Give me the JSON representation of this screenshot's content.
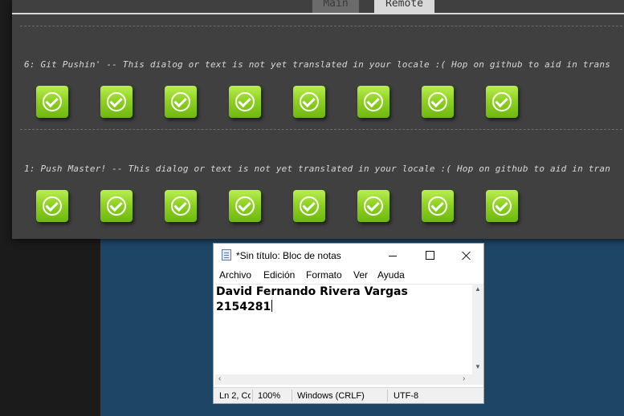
{
  "dialog": {
    "tabs": [
      {
        "label": "Main",
        "active": false
      },
      {
        "label": "Remote",
        "active": true
      }
    ],
    "levels": [
      {
        "text": "6: Git Pushin' -- This dialog or text is not yet translated in your locale :( Hop on github to aid in trans",
        "completed_count": 8
      },
      {
        "text": "1: Push Master! -- This dialog or text is not yet translated in your locale :( Hop on github to aid in tran",
        "completed_count": 8
      }
    ],
    "check_icon": "green-check-badge-icon"
  },
  "notepad": {
    "title": "*Sin título: Bloc de notas",
    "menu": [
      "Archivo",
      "Edición",
      "Formato",
      "Ver",
      "Ayuda"
    ],
    "content": [
      "David Fernando Rivera Vargas",
      "2154281"
    ],
    "status": {
      "position": "Ln 2, Co",
      "zoom": "100%",
      "line_ending": "Windows (CRLF)",
      "encoding": "UTF-8"
    }
  },
  "colors": {
    "dialog_bg": "#404040",
    "check_green": "#8fd21f",
    "desktop_blue": "#1d4566"
  }
}
